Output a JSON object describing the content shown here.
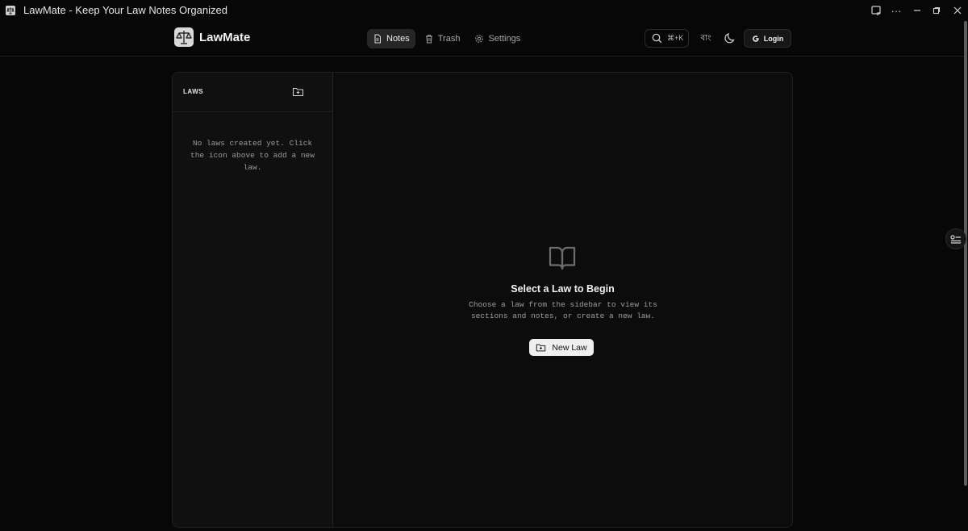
{
  "window": {
    "title": "LawMate - Keep Your Law Notes Organized"
  },
  "header": {
    "brand": "LawMate",
    "nav": [
      {
        "label": "Notes",
        "active": true,
        "icon": "file-text-icon"
      },
      {
        "label": "Trash",
        "active": false,
        "icon": "trash-icon"
      },
      {
        "label": "Settings",
        "active": false,
        "icon": "gear-icon"
      }
    ],
    "search_shortcut": "⌘+K",
    "language_label": "বাং",
    "login_label": "Login"
  },
  "sidebar": {
    "title": "LAWS",
    "empty_message": "No laws created yet. Click the icon above to add a new law."
  },
  "main": {
    "title": "Select a Law to Begin",
    "description": "Choose a law from the sidebar to view its sections and notes, or create a new law.",
    "new_law_label": "New Law"
  },
  "colors": {
    "background": "#070707",
    "panel": "#0c0c0c",
    "sidebar": "#101010",
    "button_light": "#efefef",
    "active_nav": "#262626"
  }
}
